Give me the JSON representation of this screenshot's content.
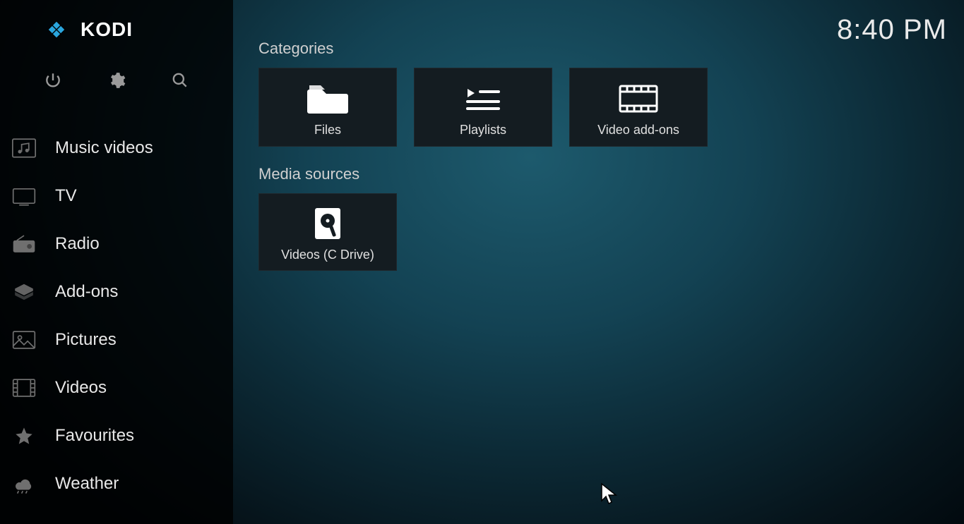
{
  "brand": {
    "name": "KODI"
  },
  "clock": "8:40 PM",
  "sidebar": {
    "items": [
      {
        "label": "Music videos",
        "icon": "music-video-icon"
      },
      {
        "label": "TV",
        "icon": "tv-icon"
      },
      {
        "label": "Radio",
        "icon": "radio-icon"
      },
      {
        "label": "Add-ons",
        "icon": "addons-icon"
      },
      {
        "label": "Pictures",
        "icon": "pictures-icon"
      },
      {
        "label": "Videos",
        "icon": "videos-icon"
      },
      {
        "label": "Favourites",
        "icon": "star-icon"
      },
      {
        "label": "Weather",
        "icon": "weather-icon"
      }
    ]
  },
  "sections": {
    "categories_title": "Categories",
    "categories": [
      {
        "label": "Files",
        "icon": "folder-icon"
      },
      {
        "label": "Playlists",
        "icon": "playlist-icon"
      },
      {
        "label": "Video add-ons",
        "icon": "film-icon"
      }
    ],
    "media_sources_title": "Media sources",
    "media_sources": [
      {
        "label": "Videos (C Drive)",
        "icon": "drive-icon"
      }
    ]
  }
}
